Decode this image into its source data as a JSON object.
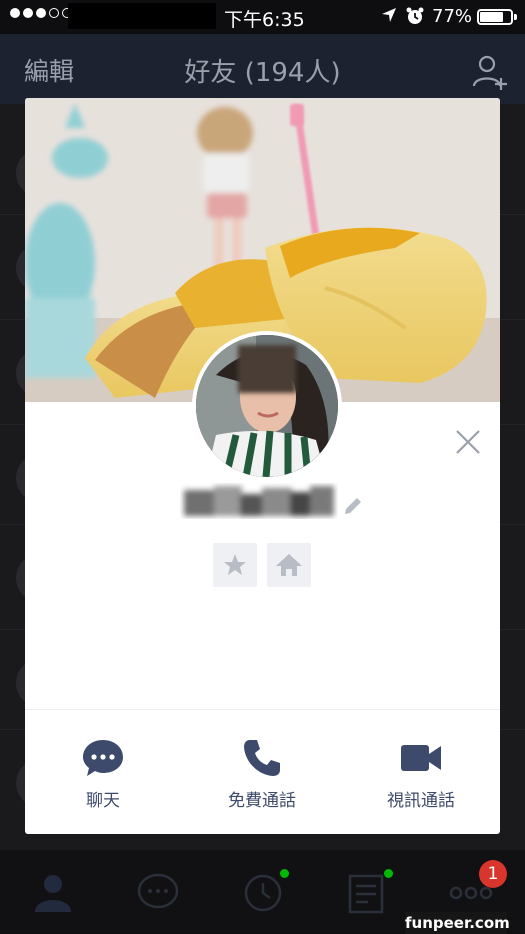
{
  "status_bar": {
    "time": "下午6:35",
    "battery": "77%",
    "battery_level": 0.77
  },
  "header": {
    "edit_label": "編輯",
    "title": "好友 (194人)"
  },
  "profile_modal": {
    "actions": [
      {
        "label": "聊天",
        "icon": "chat-bubble-icon"
      },
      {
        "label": "免費通話",
        "icon": "phone-icon"
      },
      {
        "label": "視訊通話",
        "icon": "video-camera-icon"
      }
    ]
  },
  "tabbar": {
    "tabs": [
      "friends-icon",
      "chats-icon",
      "timeline-icon",
      "news-icon",
      "more-icon"
    ],
    "more_badge": "1"
  },
  "watermark": "funpeer.com",
  "colors": {
    "accent": "#3d4a6b",
    "badge": "#d8352c",
    "online": "#00b900",
    "header_bg": "#1c2230"
  }
}
